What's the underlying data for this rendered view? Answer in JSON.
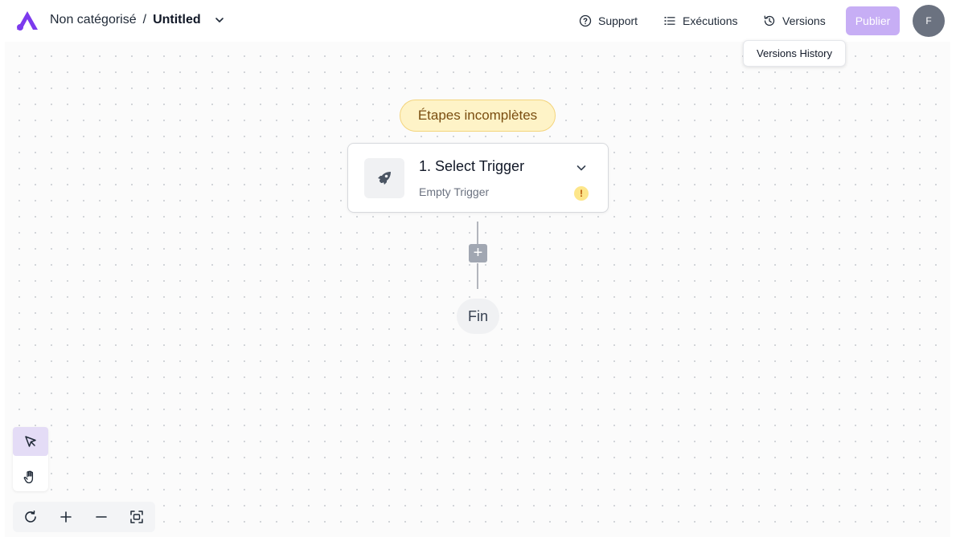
{
  "header": {
    "breadcrumb_folder": "Non catégorisé",
    "breadcrumb_separator": "/",
    "flow_title": "Untitled",
    "support_label": "Support",
    "executions_label": "Exécutions",
    "versions_label": "Versions",
    "publish_label": "Publier",
    "avatar_initial": "F"
  },
  "tooltip": {
    "text": "Versions History"
  },
  "canvas": {
    "incomplete_badge": "Étapes incomplètes",
    "step": {
      "title": "1. Select Trigger",
      "subtitle": "Empty Trigger",
      "warning_symbol": "!"
    },
    "add_symbol": "+",
    "end_label": "Fin"
  },
  "colors": {
    "brand": "#7c3aed",
    "publish_bg": "#c7aef5",
    "warning_bg": "#fef3c7",
    "active_tool_bg": "#e4dcf6"
  },
  "icons": {
    "logo": "app-logo",
    "support": "help-circle-icon",
    "executions": "list-icon",
    "versions": "history-icon",
    "trigger": "trigger-icon",
    "chevron": "chevron-down-icon",
    "pointer": "cursor-pointer-icon",
    "hand": "hand-pan-icon",
    "refresh": "refresh-icon",
    "zoom_in": "plus-icon",
    "zoom_out": "minus-icon",
    "fit": "fit-view-icon"
  }
}
